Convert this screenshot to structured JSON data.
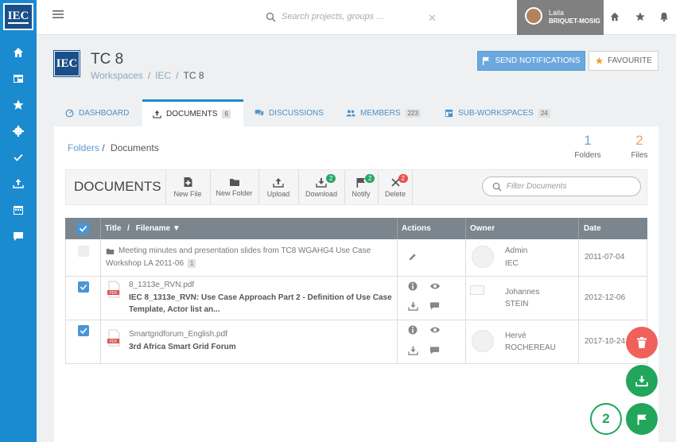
{
  "app": {
    "logo_text": "IEC"
  },
  "topbar": {
    "search_placeholder": "Search projects, groups ...",
    "user_first": "Laila",
    "user_last": "BRIQUET-MOSIG"
  },
  "header": {
    "logo_text": "IEC",
    "title": "TC 8",
    "breadcrumb": [
      "Workspaces",
      "IEC",
      "TC 8"
    ],
    "send_label": "SEND NOTIFICATIONS",
    "fav_label": "FAVOURITE"
  },
  "tabs": [
    {
      "label": "DASHBOARD",
      "count": ""
    },
    {
      "label": "DOCUMENTS",
      "count": "6"
    },
    {
      "label": "DISCUSSIONS",
      "count": ""
    },
    {
      "label": "MEMBERS",
      "count": "223"
    },
    {
      "label": "SUB-WORKSPACES",
      "count": "24"
    }
  ],
  "panel": {
    "breadcrumb_root": "Folders",
    "breadcrumb_current": "Documents",
    "folders_count": "1",
    "folders_label": "Folders",
    "files_count": "2",
    "files_label": "Files"
  },
  "toolbar": {
    "title": "DOCUMENTS",
    "new_file": "New File",
    "new_folder": "New Folder",
    "upload": "Upload",
    "download": "Download",
    "download_badge": "2",
    "notify": "Notify",
    "notify_badge": "2",
    "delete": "Delete",
    "delete_badge": "2",
    "filter_placeholder": "Filter Documents"
  },
  "table": {
    "columns": {
      "title": "Title",
      "sep": "/",
      "filename": "Filename",
      "actions": "Actions",
      "owner": "Owner",
      "date": "Date"
    },
    "rows": [
      {
        "name": "Meeting minutes and presentation slides from TC8 WGAHG4 Use Case",
        "name2": "Workshop LA 2011-06",
        "count": "1",
        "owner1": "Admin",
        "owner2": "IEC",
        "date": "2011-07-04"
      },
      {
        "file": "8_1313e_RVN.pdf",
        "title": "IEC 8_1313e_RVN: Use Case Approach Part 2 - Definition of Use Case",
        "title2": "Template, Actor list an...",
        "owner1": "Johannes",
        "owner2": "STEIN",
        "date": "2012-12-06"
      },
      {
        "file": "Smartgridforum_English.pdf",
        "title": "3rd Africa Smart Grid Forum",
        "owner1": "Hervé",
        "owner2": "ROCHEREAU",
        "date": "2017-10-24"
      }
    ]
  },
  "pdf_label": "PDF",
  "fab": {
    "count": "2"
  },
  "colors": {
    "accent": "#1b8bd0",
    "danger": "#f0615b",
    "success": "#21a65b"
  }
}
